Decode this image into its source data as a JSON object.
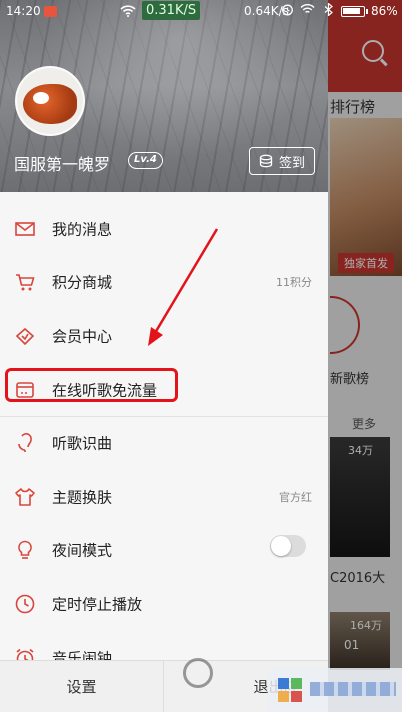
{
  "status_bar": {
    "time": "14:20",
    "speed_up": "0.31K/S",
    "speed_down": "0.64K/s",
    "battery": "86%"
  },
  "drawer": {
    "username": "国服第一魄罗",
    "level": "Lv.4",
    "signin_label": "签到",
    "menu": [
      {
        "label": "我的消息",
        "icon": "mail-icon",
        "right": ""
      },
      {
        "label": "积分商城",
        "icon": "cart-icon",
        "right": "11积分"
      },
      {
        "label": "会员中心",
        "icon": "vip-diamond-icon",
        "right": ""
      },
      {
        "label": "在线听歌免流量",
        "icon": "sim-card-icon",
        "right": ""
      },
      {
        "label": "听歌识曲",
        "icon": "microphone-icon",
        "right": ""
      },
      {
        "label": "主题换肤",
        "icon": "tshirt-icon",
        "right": "官方红"
      },
      {
        "label": "夜间模式",
        "icon": "lightbulb-icon",
        "right": ""
      },
      {
        "label": "定时停止播放",
        "icon": "clock-icon",
        "right": ""
      },
      {
        "label": "音乐闹钟",
        "icon": "alarm-icon",
        "right": ""
      }
    ],
    "settings_label": "设置",
    "exit_label": "退出应"
  },
  "background": {
    "rank_label": "排行榜",
    "banner_tag": "独家首发",
    "new_songs": "新歌榜",
    "more": "更多",
    "card1_plays": "34万",
    "card1_title": "C2016大",
    "card2_plays": "164万",
    "card2_text": "01"
  },
  "colors": {
    "accent": "#c8362f",
    "highlight": "#e4121b",
    "icon": "#d9453d"
  }
}
